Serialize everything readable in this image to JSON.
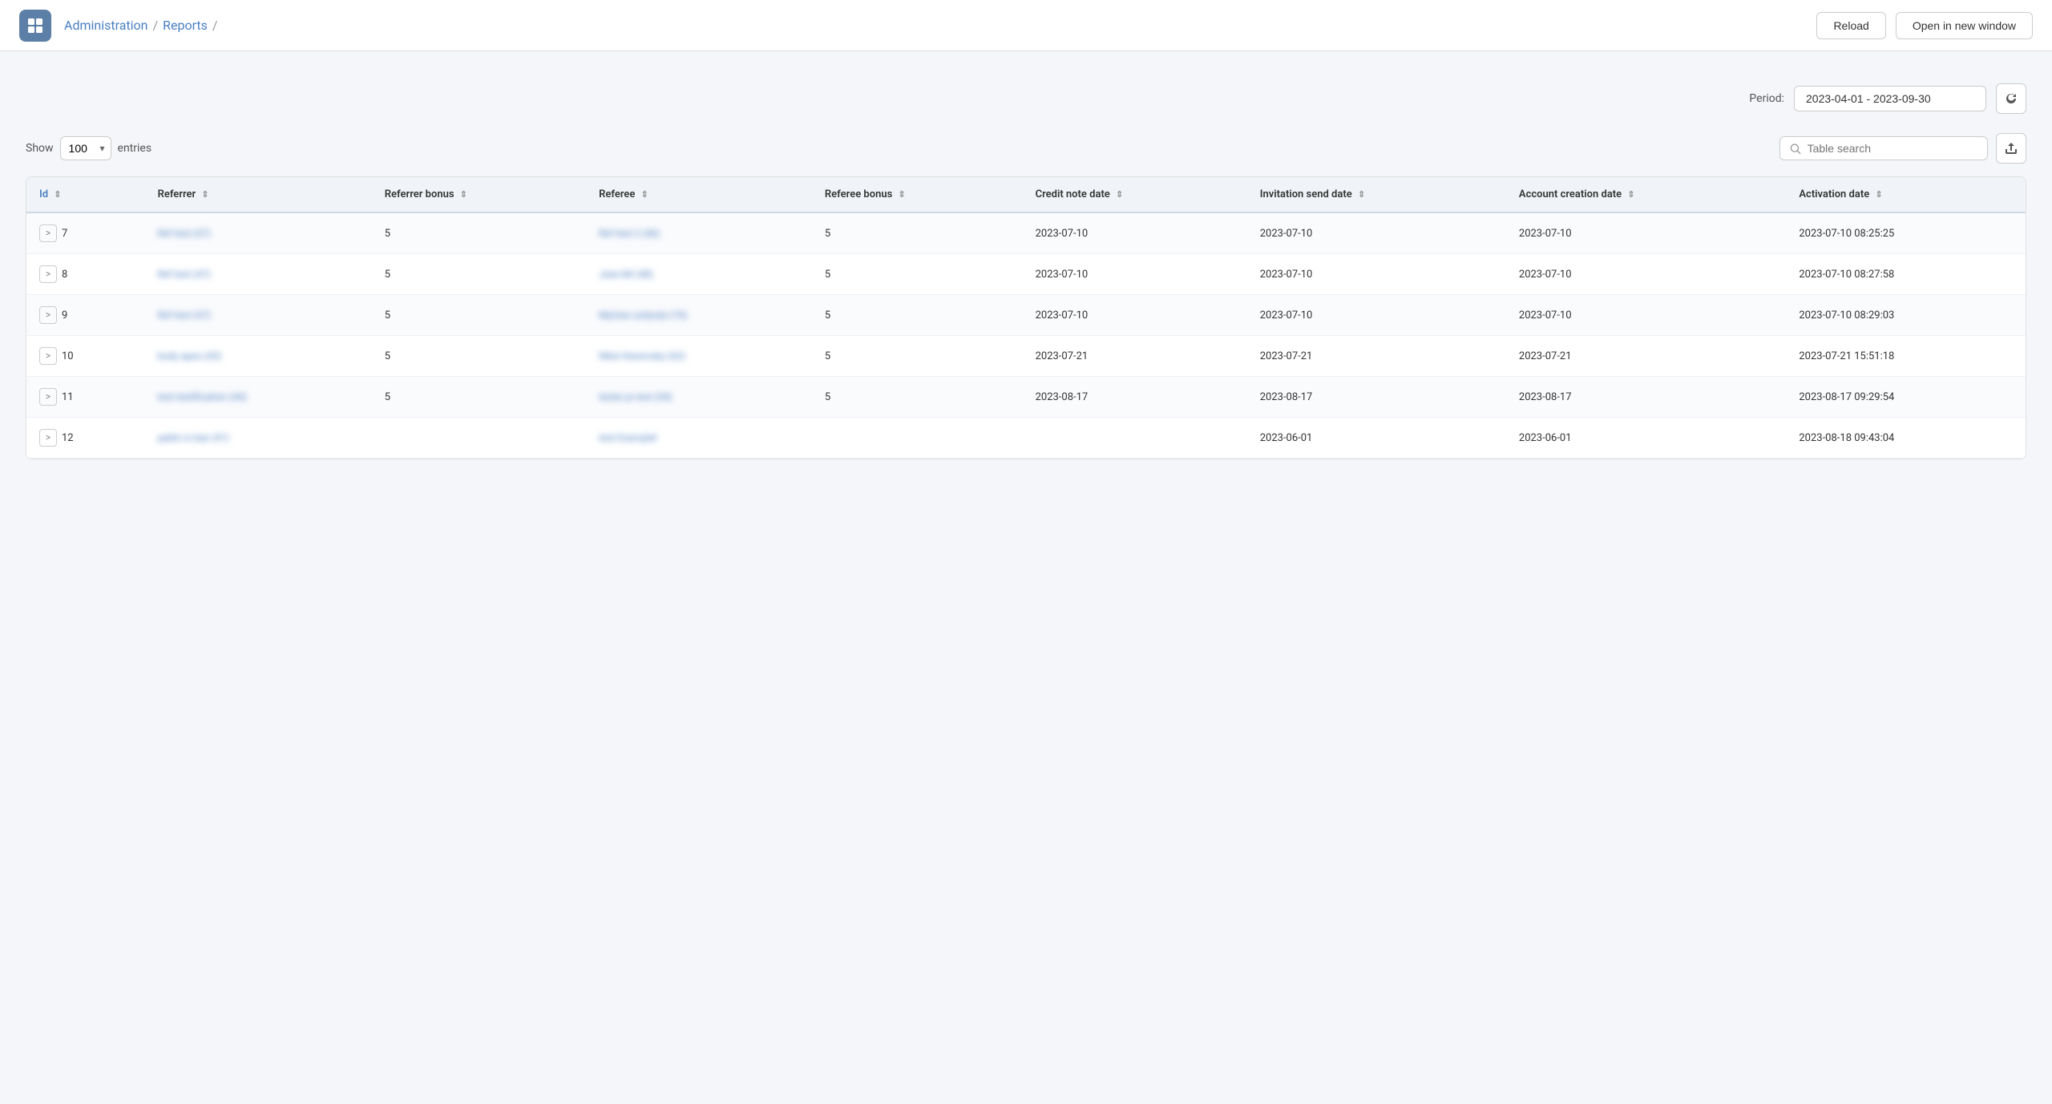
{
  "header": {
    "app_icon": "☰",
    "breadcrumb": {
      "admin_label": "Administration",
      "sep1": "/",
      "reports_label": "Reports",
      "sep2": "/"
    },
    "reload_btn": "Reload",
    "open_new_window_btn": "Open in new window"
  },
  "controls": {
    "period_label": "Period:",
    "period_value": "2023-04-01 - 2023-09-30",
    "show_label": "Show",
    "entries_value": "100",
    "entries_label": "entries",
    "search_placeholder": "Table search"
  },
  "table": {
    "columns": [
      {
        "key": "id",
        "label": "Id"
      },
      {
        "key": "referrer",
        "label": "Referrer"
      },
      {
        "key": "referrer_bonus",
        "label": "Referrer bonus"
      },
      {
        "key": "referee",
        "label": "Referee"
      },
      {
        "key": "referee_bonus",
        "label": "Referee bonus"
      },
      {
        "key": "credit_note_date",
        "label": "Credit note date"
      },
      {
        "key": "invitation_send_date",
        "label": "Invitation send date"
      },
      {
        "key": "account_creation_date",
        "label": "Account creation date"
      },
      {
        "key": "activation_date",
        "label": "Activation date"
      }
    ],
    "rows": [
      {
        "id": "7",
        "referrer": "Ref test (47)",
        "referrer_bonus": "5",
        "referee": "Ref test 2 (46)",
        "referee_bonus": "5",
        "credit_note_date": "2023-07-10",
        "invitation_send_date": "2023-07-10",
        "account_creation_date": "2023-07-10",
        "activation_date": "2023-07-10 08:25:25"
      },
      {
        "id": "8",
        "referrer": "Ref test (47)",
        "referrer_bonus": "5",
        "referee": "Jean-Mi (48)",
        "referee_bonus": "5",
        "credit_note_date": "2023-07-10",
        "invitation_send_date": "2023-07-10",
        "account_creation_date": "2023-07-10",
        "activation_date": "2023-07-10 08:27:58"
      },
      {
        "id": "9",
        "referrer": "Ref test (47)",
        "referrer_bonus": "5",
        "referee": "MyUser yoilyolyi (76)",
        "referee_bonus": "5",
        "credit_note_date": "2023-07-10",
        "invitation_send_date": "2023-07-10",
        "account_creation_date": "2023-07-10",
        "activation_date": "2023-07-10 08:29:03"
      },
      {
        "id": "10",
        "referrer": "body apes (43)",
        "referrer_bonus": "5",
        "referee": "Nikoì Karemsky (62)",
        "referee_bonus": "5",
        "credit_note_date": "2023-07-21",
        "invitation_send_date": "2023-07-21",
        "account_creation_date": "2023-07-21",
        "activation_date": "2023-07-21 15:51:18"
      },
      {
        "id": "11",
        "referrer": "test testification (44)",
        "referrer_bonus": "5",
        "referee": "tester je test (54)",
        "referee_bonus": "5",
        "credit_note_date": "2023-08-17",
        "invitation_send_date": "2023-08-17",
        "account_creation_date": "2023-08-17",
        "activation_date": "2023-08-17 09:29:54"
      },
      {
        "id": "12",
        "referrer": "pablo is bae (41)",
        "referrer_bonus": "",
        "referee": "test Examplel",
        "referee_bonus": "",
        "credit_note_date": "",
        "invitation_send_date": "2023-06-01",
        "account_creation_date": "2023-06-01",
        "activation_date": "2023-08-18 09:43:04"
      }
    ]
  }
}
